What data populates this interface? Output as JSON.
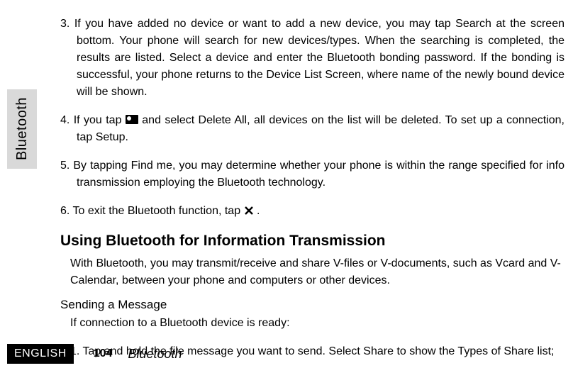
{
  "side_tab": "Bluetooth",
  "items": {
    "i3": "3. If you have added no device or want to add a new device, you may tap Search at the screen bottom. Your phone will search for new devices/types. When the searching is completed, the results are listed. Select a device and enter the Bluetooth bonding password. If the bonding is successful, your phone returns to the Device List Screen, where name of the newly bound device will be shown.",
    "i4_pre": "4. If you tap ",
    "i4_post": " and select Delete All, all devices on the list will be deleted. To set up a connection, tap Setup.",
    "i5": "5. By tapping Find me, you may determine whether your phone is within the range specified for info transmission employing the Bluetooth technology.",
    "i6_pre": "6. To exit the Bluetooth function, tap ",
    "i6_post": " ."
  },
  "section_title": "Using Bluetooth for Information Transmission",
  "section_para": "With Bluetooth, you may transmit/receive and share V-files or V-documents, such as Vcard and V-Calendar, between your phone and computers or other devices.",
  "sub_title": "Sending a Message",
  "sub_lead": "If connection to a Bluetooth device is ready:",
  "sub_item1": "1. Tap and hold the file message you want to send. Select Share to show the Types of Share list;",
  "footer": {
    "language": "ENGLISH",
    "page_number": "104",
    "section": "Bluetooth"
  }
}
